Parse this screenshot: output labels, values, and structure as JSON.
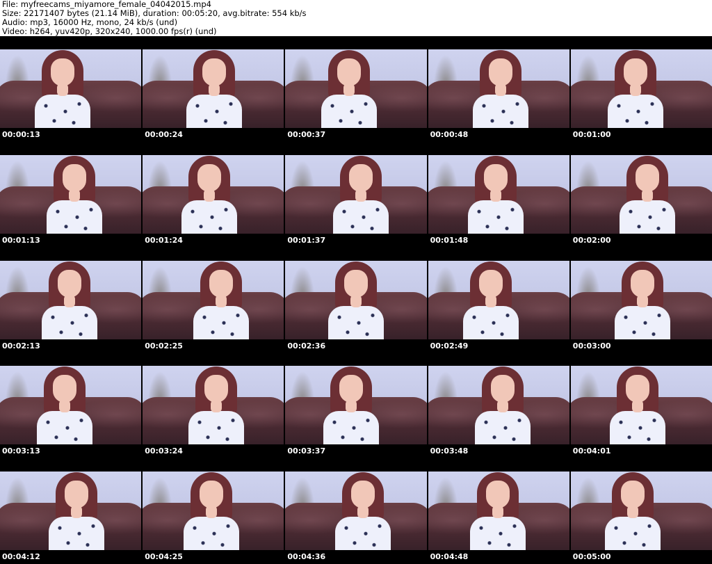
{
  "header": {
    "file_line": "File: myfreecams_miyamore_female_04042015.mp4",
    "size_line": "Size: 22171407 bytes (21.14 MiB), duration: 00:05:20, avg.bitrate: 554 kb/s",
    "audio_line": "Audio: mp3, 16000 Hz, mono, 24 kb/s (und)",
    "video_line": "Video: h264, yuv420p, 320x240, 1000.00 fps(r) (und)"
  },
  "thumbnails": [
    {
      "time": "00:00:13"
    },
    {
      "time": "00:00:24"
    },
    {
      "time": "00:00:37"
    },
    {
      "time": "00:00:48"
    },
    {
      "time": "00:01:00"
    },
    {
      "time": "00:01:13"
    },
    {
      "time": "00:01:24"
    },
    {
      "time": "00:01:37"
    },
    {
      "time": "00:01:48"
    },
    {
      "time": "00:02:00"
    },
    {
      "time": "00:02:13"
    },
    {
      "time": "00:02:25"
    },
    {
      "time": "00:02:36"
    },
    {
      "time": "00:02:49"
    },
    {
      "time": "00:03:00"
    },
    {
      "time": "00:03:13"
    },
    {
      "time": "00:03:24"
    },
    {
      "time": "00:03:37"
    },
    {
      "time": "00:03:48"
    },
    {
      "time": "00:04:01"
    },
    {
      "time": "00:04:12"
    },
    {
      "time": "00:04:25"
    },
    {
      "time": "00:04:36"
    },
    {
      "time": "00:04:48"
    },
    {
      "time": "00:05:00"
    }
  ]
}
